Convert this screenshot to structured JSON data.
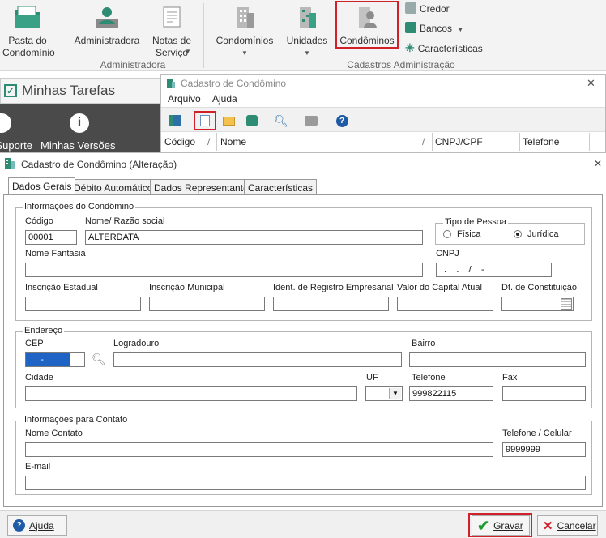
{
  "ribbon": {
    "pasta": {
      "label": "Pasta do Condomínio"
    },
    "administradora": {
      "label": "Administradora"
    },
    "notas": {
      "label": "Notas de Serviço"
    },
    "condominios_menu": {
      "label": "Condomínios"
    },
    "unidades": {
      "label": "Unidades"
    },
    "condominos": {
      "label": "Condôminos"
    },
    "credor": {
      "label": "Credor"
    },
    "bancos": {
      "label": "Bancos"
    },
    "caracteristicas": {
      "label": "Características"
    },
    "group_admin": "Administradora",
    "group_cadastros": "Cadastros Administração"
  },
  "left_panel": {
    "title": "Minhas Tarefas",
    "suporte": "Suporte",
    "versoes": "Minhas Versões"
  },
  "bg_window": {
    "title": "Cadastro de Condômino",
    "menu": [
      "Arquivo",
      "Ajuda"
    ],
    "columns": [
      "Código",
      "Nome",
      "CNPJ/CPF",
      "Telefone"
    ]
  },
  "dialog": {
    "title": "Cadastro de Condômino (Alteração)",
    "tabs": [
      "Dados Gerais",
      "Débito Automático",
      "Dados Representante",
      "Características"
    ],
    "info": {
      "legend": "Informações do Condômino",
      "codigo_label": "Código",
      "codigo": "00001",
      "nome_label": "Nome/ Razão social",
      "nome": "ALTERDATA",
      "tipo_legend": "Tipo de Pessoa",
      "fisica": "Física",
      "juridica": "Jurídica",
      "fantasia_label": "Nome Fantasia",
      "fantasia": "",
      "cnpj_label": "CNPJ",
      "cnpj": "  .    .    /    -",
      "ie_label": "Inscrição Estadual",
      "im_label": "Inscrição Municipal",
      "ident_label": "Ident. de Registro Empresarial",
      "capital_label": "Valor do Capital Atual",
      "dt_label": "Dt. de Constituição"
    },
    "endereco": {
      "legend": "Endereço",
      "cep_label": "CEP",
      "cep": "     -",
      "logradouro_label": "Logradouro",
      "bairro_label": "Bairro",
      "cidade_label": "Cidade",
      "uf_label": "UF",
      "telefone_label": "Telefone",
      "telefone": "999822115",
      "fax_label": "Fax"
    },
    "contato": {
      "legend": "Informações para Contato",
      "nome_label": "Nome Contato",
      "celular_label": "Telefone / Celular",
      "celular": "9999999",
      "email_label": "E-mail"
    },
    "buttons": {
      "ajuda": "Ajuda",
      "gravar": "Gravar",
      "cancelar": "Cancelar"
    }
  },
  "colors": {
    "accent_red": "#d0202a",
    "teal": "#2e8b74",
    "panel": "#4a4a4a"
  }
}
